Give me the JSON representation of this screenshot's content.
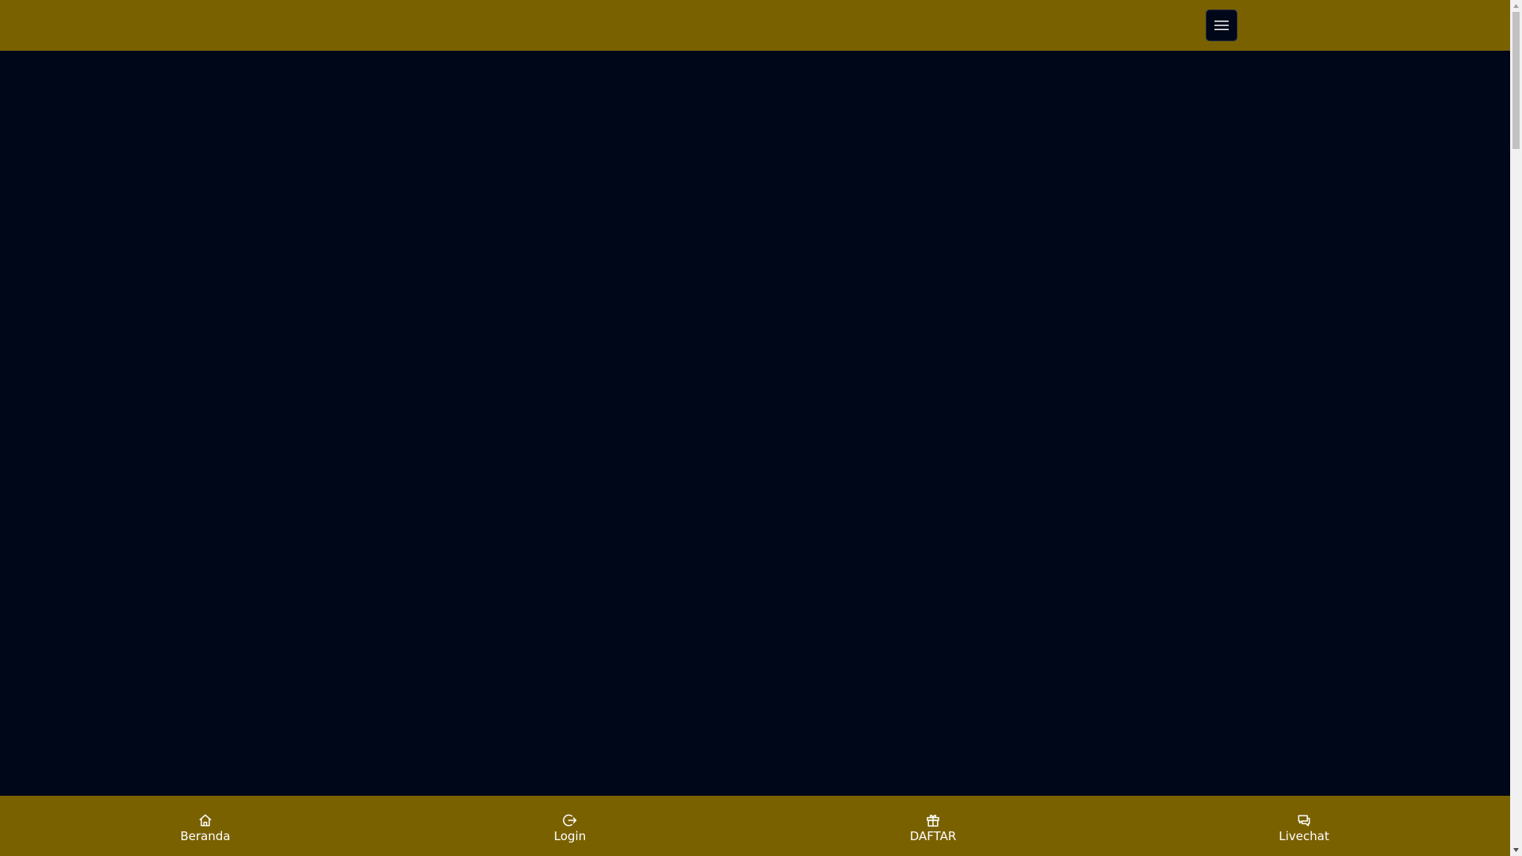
{
  "header": {
    "menu_button_icon": "hamburger-menu-icon"
  },
  "bottom_nav": {
    "items": [
      {
        "label": "Beranda",
        "icon": "home-icon"
      },
      {
        "label": "Login",
        "icon": "login-icon"
      },
      {
        "label": "DAFTAR",
        "icon": "gift-icon"
      },
      {
        "label": "Livechat",
        "icon": "chat-icon"
      }
    ]
  },
  "colors": {
    "brand_gold": "#7a6100",
    "background_navy": "#000718",
    "nav_text": "#ffffff"
  }
}
